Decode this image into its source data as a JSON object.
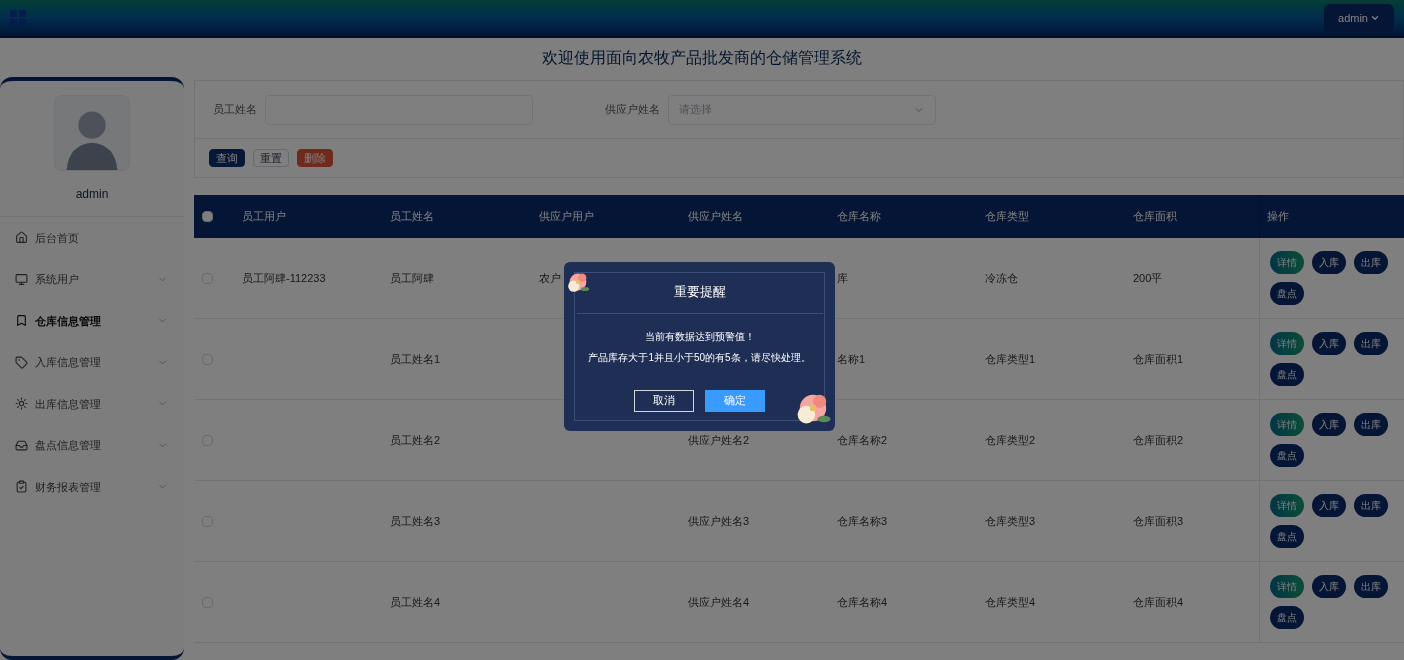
{
  "header": {
    "user_menu": "admin"
  },
  "page_title": "欢迎使用面向农牧产品批发商的仓储管理系统",
  "sidebar": {
    "username": "admin",
    "items": [
      {
        "label": "后台首页",
        "selected": false
      },
      {
        "label": "系统用户",
        "selected": false,
        "expanded": false
      },
      {
        "label": "仓库信息管理",
        "selected": true,
        "expanded": false
      },
      {
        "label": "入库信息管理",
        "selected": false,
        "expanded": false
      },
      {
        "label": "出库信息管理",
        "selected": false,
        "expanded": false
      },
      {
        "label": "盘点信息管理",
        "selected": false,
        "expanded": false
      },
      {
        "label": "财务报表管理",
        "selected": false,
        "expanded": false
      }
    ]
  },
  "filters": {
    "fields": [
      {
        "label": "员工姓名",
        "kind": "input"
      },
      {
        "label": "供应户姓名",
        "kind": "select",
        "placeholder": "请选择"
      }
    ],
    "buttons": [
      {
        "label": "查询",
        "kind": "primary"
      },
      {
        "label": "重置",
        "kind": "outline"
      },
      {
        "label": "删除",
        "kind": "danger"
      }
    ]
  },
  "table": {
    "select_all": {
      "checked": false
    },
    "columns": [
      "员工用户",
      "员工姓名",
      "供应户用户",
      "供应户姓名",
      "仓库名称",
      "仓库类型",
      "仓库面积",
      "操作"
    ],
    "rows": [
      {
        "checked": false,
        "cells": [
          "员工阿肆-112233",
          "员工阿肆",
          "农户",
          "",
          "库",
          "冷冻仓",
          "200平"
        ],
        "actions": [
          {
            "label": "详情",
            "kind": "gradient"
          },
          {
            "label": "入库",
            "kind": "solid"
          },
          {
            "label": "出库",
            "kind": "solid"
          },
          {
            "label": "盘点",
            "kind": "solid"
          }
        ]
      },
      {
        "checked": false,
        "cells": [
          "",
          "员工姓名1",
          "",
          "",
          "名称1",
          "仓库类型1",
          "仓库面积1"
        ],
        "actions": [
          {
            "label": "详情",
            "kind": "gradient"
          },
          {
            "label": "入库",
            "kind": "solid"
          },
          {
            "label": "出库",
            "kind": "solid"
          },
          {
            "label": "盘点",
            "kind": "solid"
          }
        ]
      },
      {
        "checked": false,
        "cells": [
          "",
          "员工姓名2",
          "",
          "供应户姓名2",
          "仓库名称2",
          "仓库类型2",
          "仓库面积2"
        ],
        "actions": [
          {
            "label": "详情",
            "kind": "gradient"
          },
          {
            "label": "入库",
            "kind": "solid"
          },
          {
            "label": "出库",
            "kind": "solid"
          },
          {
            "label": "盘点",
            "kind": "solid"
          }
        ]
      },
      {
        "checked": false,
        "cells": [
          "",
          "员工姓名3",
          "",
          "供应户姓名3",
          "仓库名称3",
          "仓库类型3",
          "仓库面积3"
        ],
        "actions": [
          {
            "label": "详情",
            "kind": "gradient"
          },
          {
            "label": "入库",
            "kind": "solid"
          },
          {
            "label": "出库",
            "kind": "solid"
          },
          {
            "label": "盘点",
            "kind": "solid"
          }
        ]
      },
      {
        "checked": false,
        "cells": [
          "",
          "员工姓名4",
          "",
          "供应户姓名4",
          "仓库名称4",
          "仓库类型4",
          "仓库面积4"
        ],
        "actions": [
          {
            "label": "详情",
            "kind": "gradient"
          },
          {
            "label": "入库",
            "kind": "solid"
          },
          {
            "label": "出库",
            "kind": "solid"
          },
          {
            "label": "盘点",
            "kind": "solid"
          }
        ]
      }
    ]
  },
  "dialog": {
    "title": "重要提醒",
    "lines": [
      "当前有数据达到预警值！",
      "产品库存大于1并且小于50的有5条，请尽快处理。"
    ],
    "buttons": [
      {
        "label": "取消",
        "kind": "outline"
      },
      {
        "label": "确定",
        "kind": "primary"
      }
    ]
  }
}
